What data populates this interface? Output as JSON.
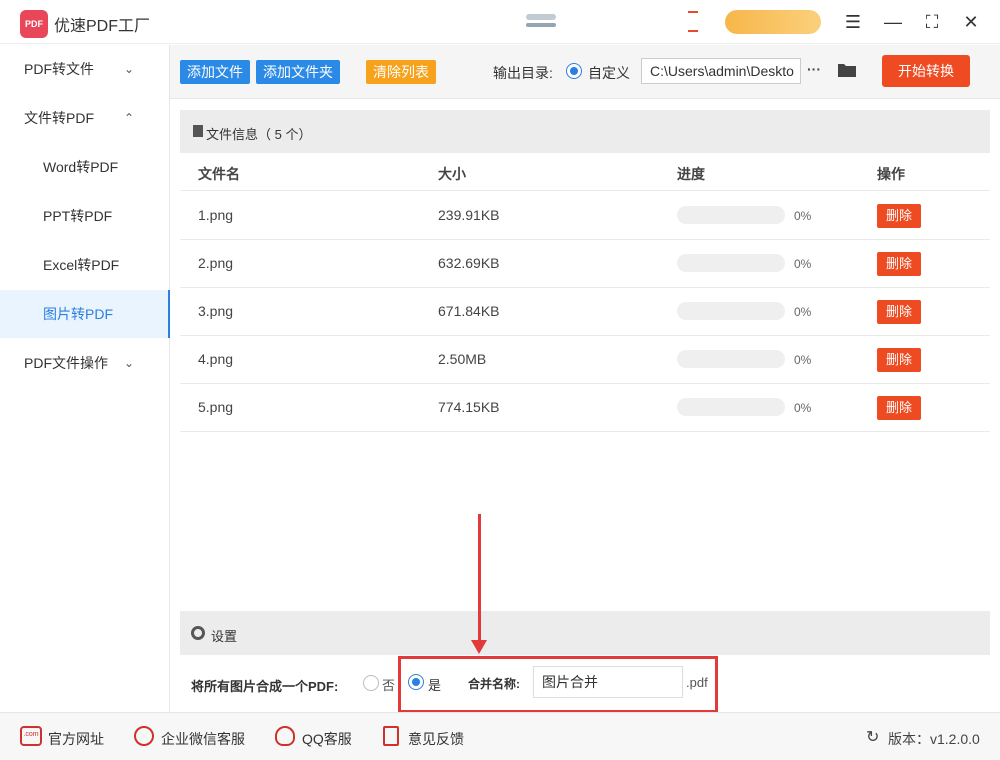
{
  "app": {
    "logo_text": "PDF",
    "title": "优速PDF工厂"
  },
  "window": {
    "menu_icon": "☰",
    "minimize_icon": "—",
    "maximize_icon": "⛶",
    "close_icon": "✕"
  },
  "sidebar": {
    "items": [
      {
        "label": "PDF转文件",
        "chevron": "⌄"
      },
      {
        "label": "文件转PDF",
        "chevron": "⌃"
      },
      {
        "label": "Word转PDF"
      },
      {
        "label": "PPT转PDF"
      },
      {
        "label": "Excel转PDF"
      },
      {
        "label": "图片转PDF"
      },
      {
        "label": "PDF文件操作",
        "chevron": "⌄"
      }
    ]
  },
  "toolbar": {
    "add_file": "添加文件",
    "add_folder": "添加文件夹",
    "clear_list": "清除列表",
    "output_label": "输出目录:",
    "custom_option": "自定义",
    "output_path": "C:\\Users\\admin\\Deskto",
    "more_icon": "···",
    "start": "开始转换"
  },
  "file_panel": {
    "header": "文件信息（ 5 个）",
    "columns": [
      "文件名",
      "大小",
      "进度",
      "操作"
    ],
    "rows": [
      {
        "name": "1.png",
        "size": "239.91KB",
        "progress": "0%",
        "action": "删除"
      },
      {
        "name": "2.png",
        "size": "632.69KB",
        "progress": "0%",
        "action": "删除"
      },
      {
        "name": "3.png",
        "size": "671.84KB",
        "progress": "0%",
        "action": "删除"
      },
      {
        "name": "4.png",
        "size": "2.50MB",
        "progress": "0%",
        "action": "删除"
      },
      {
        "name": "5.png",
        "size": "774.15KB",
        "progress": "0%",
        "action": "删除"
      }
    ]
  },
  "settings": {
    "header": "设置",
    "merge_label": "将所有图片合成一个PDF:",
    "option_no": "否",
    "option_yes": "是",
    "merge_name_label": "合并名称:",
    "merge_name_value": "图片合并",
    "merge_suffix": ".pdf"
  },
  "footer": {
    "website": "官方网址",
    "website_icon_text": ".com",
    "wechat": "企业微信客服",
    "qq": "QQ客服",
    "feedback": "意见反馈",
    "version": "版本：v1.2.0.0",
    "refresh_icon": "↻"
  },
  "colors": {
    "accent": "#2a8ae6",
    "primary_action": "#ef4b23",
    "warning": "#f7a21c",
    "highlight": "#e23a3a"
  }
}
